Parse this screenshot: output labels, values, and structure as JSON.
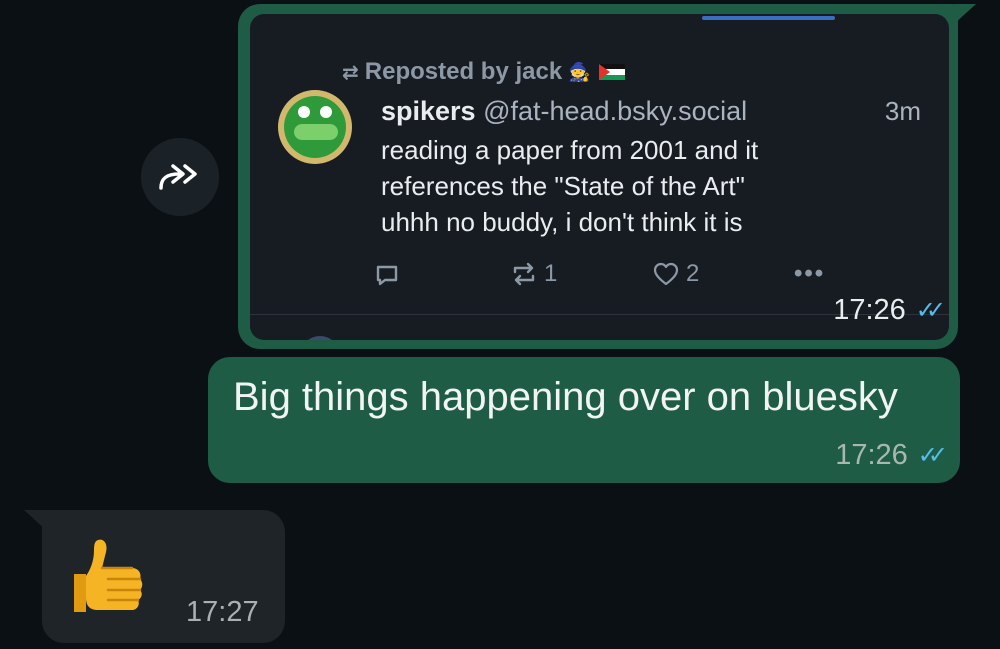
{
  "forward": {
    "icon": "forward-double-arrow-icon"
  },
  "messages": [
    {
      "direction": "outgoing",
      "embedded_post": {
        "repost_line": "Reposted by jack",
        "author_name": "spikers",
        "author_handle": "@fat-head.bsky.social",
        "age": "3m",
        "text_lines": [
          "reading a paper from 2001 and it",
          "references the \"State of the Art\"",
          "uhhh no buddy, i don't think it is"
        ],
        "reposts": "1",
        "likes": "2"
      },
      "time": "17:26",
      "status": "read"
    },
    {
      "direction": "outgoing",
      "text": "Big things happening over on bluesky",
      "time": "17:26",
      "status": "read"
    },
    {
      "direction": "incoming",
      "emoji": "thumbs-up",
      "time": "17:27"
    }
  ],
  "colors": {
    "background": "#0b1014",
    "outgoing_bubble": "#1f5c45",
    "incoming_bubble": "#1e2428",
    "read_ticks": "#53bdeb"
  }
}
